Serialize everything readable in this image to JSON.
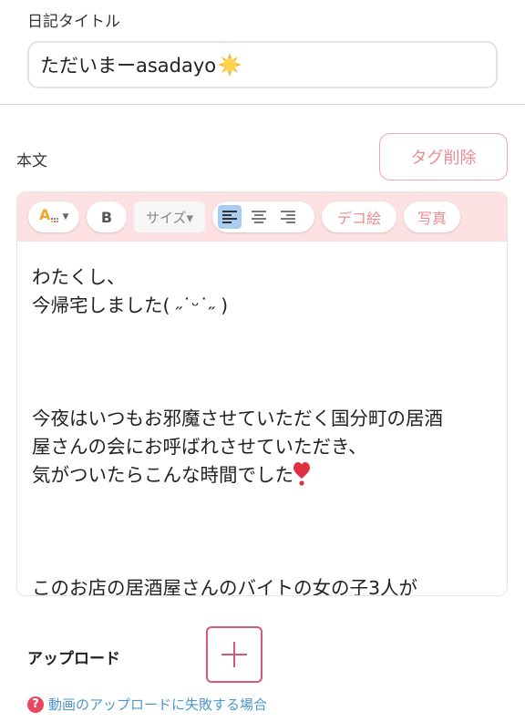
{
  "title": {
    "label": "日記タイトル",
    "value": "ただいまーasadayo",
    "emoji_icon": "sun-icon"
  },
  "body": {
    "label": "本文",
    "tag_delete_label": "タグ削除"
  },
  "toolbar": {
    "color_icon": "text-color-icon",
    "bold_label": "B",
    "size_label": "サイズ▾",
    "align_icons": [
      "align-left-icon",
      "align-center-icon",
      "align-right-icon"
    ],
    "active_align": "left",
    "deco_label": "デコ絵",
    "photo_label": "写真"
  },
  "editor": {
    "lines": [
      "わたくし、",
      "今帰宅しました( ˶˙ᵕ˙˶ )",
      "",
      "",
      "",
      "今夜はいつもお邪魔させていただく国分町の居酒",
      "屋さんの会にお呼ばれさせていただき、",
      "気がついたらこんな時間でした",
      "",
      "",
      "",
      "このお店の居酒屋さんのバイトの女の子3人が"
    ]
  },
  "upload": {
    "label": "アップロード",
    "help_text": "動画のアップロードに失敗する場合"
  },
  "colors": {
    "accent": "#ec8b93",
    "toolbar_bg": "#fde0e2",
    "upload_border": "#d5577a",
    "link": "#4b96cf"
  }
}
